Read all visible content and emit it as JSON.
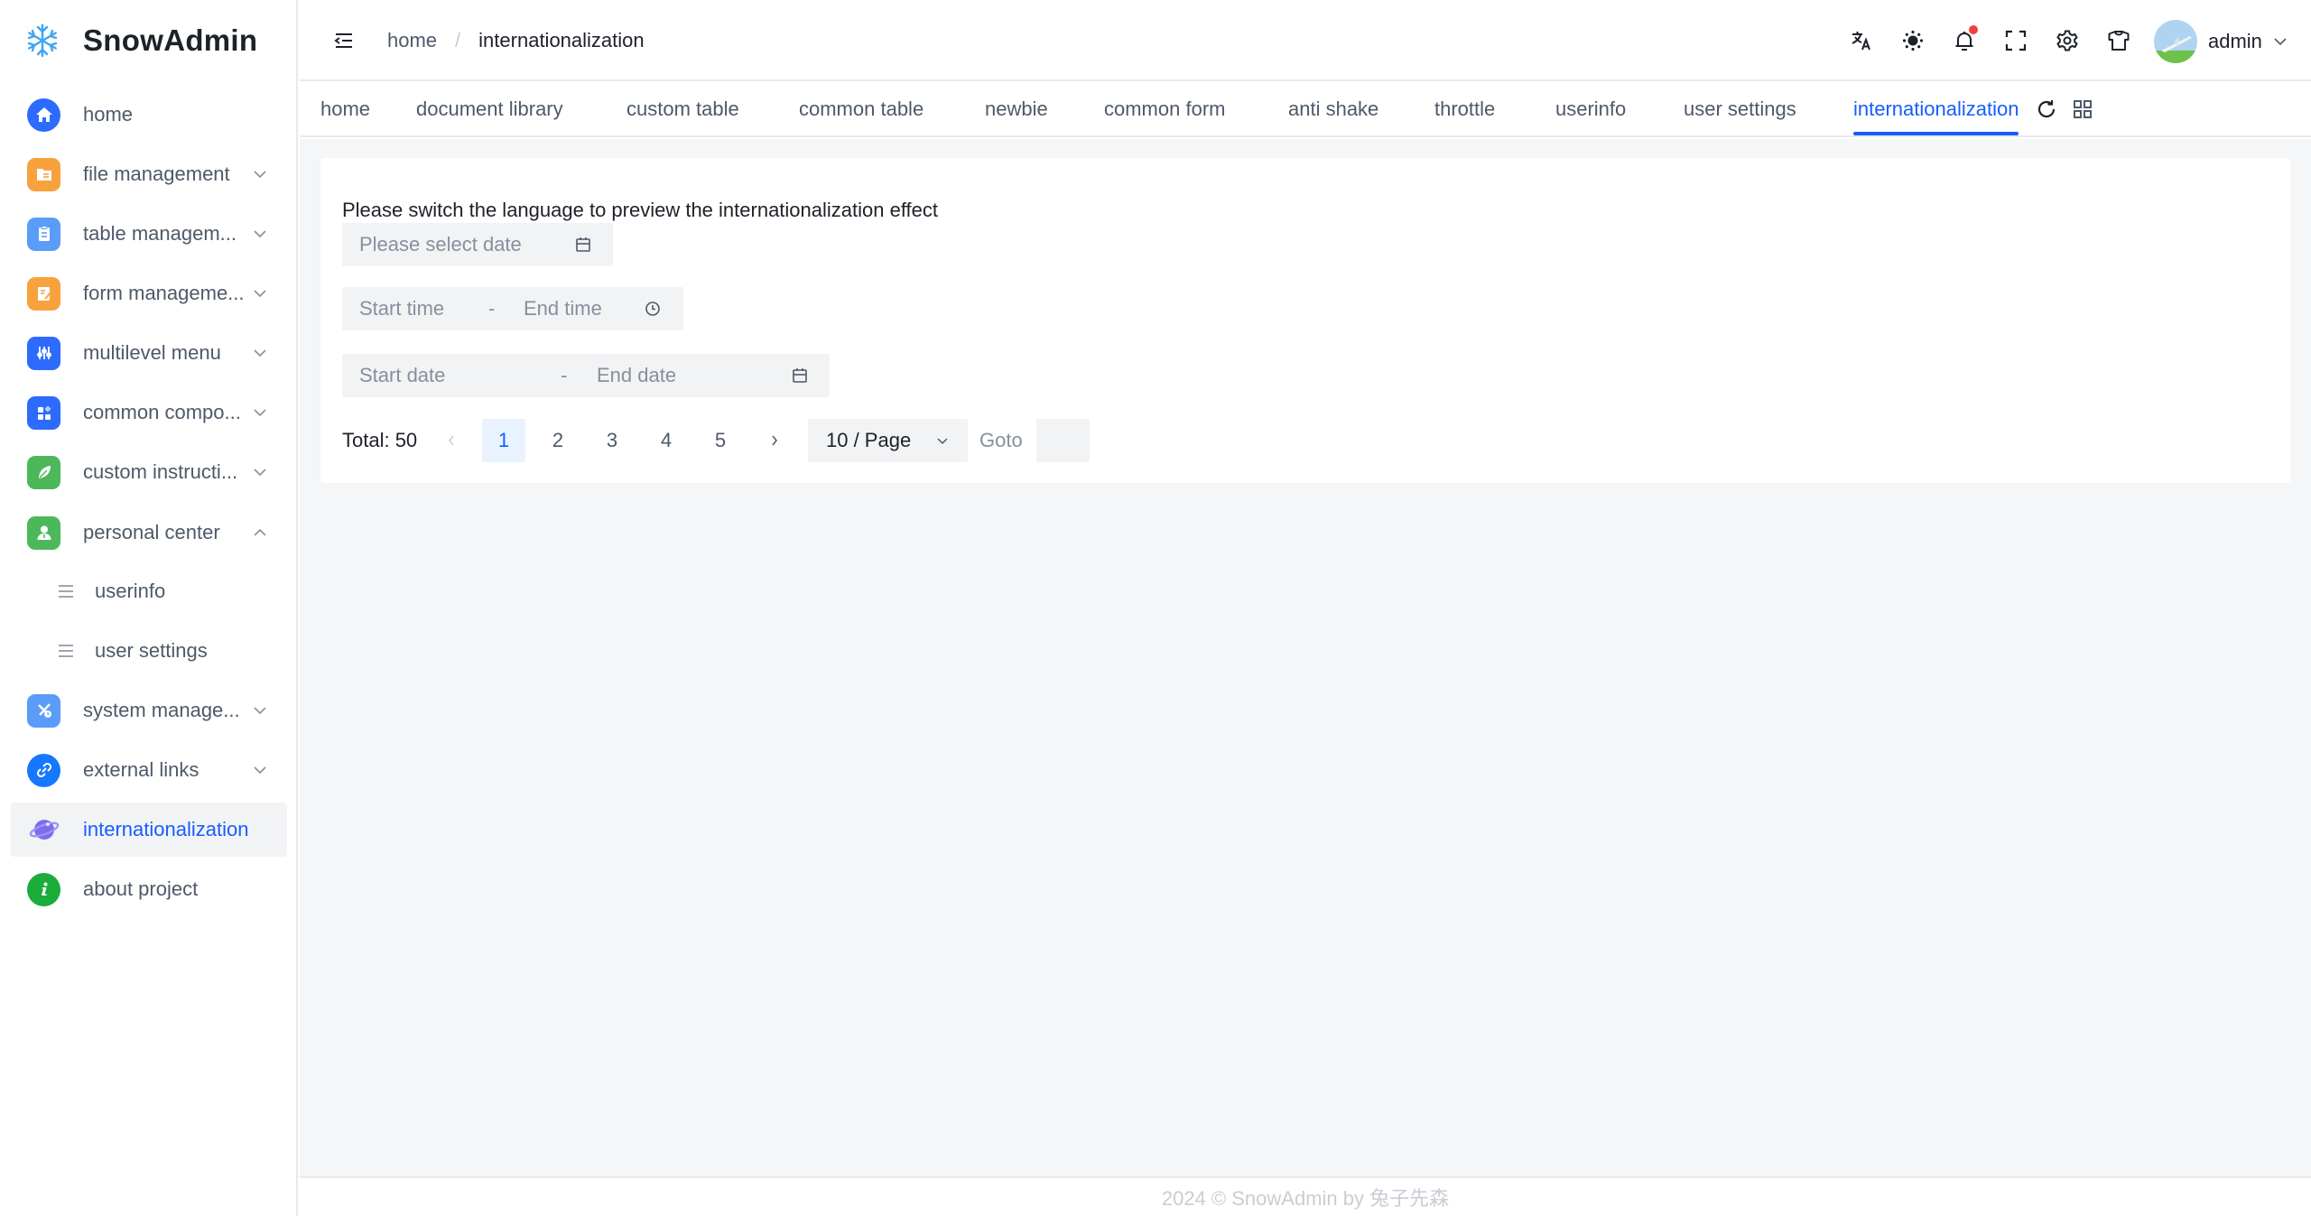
{
  "app": {
    "name": "SnowAdmin"
  },
  "sidebar": {
    "items": [
      {
        "label": "home",
        "icon": "home-icon",
        "color": "#2d6bff",
        "expandable": false
      },
      {
        "label": "file management",
        "icon": "folder-icon",
        "color": "#f7a23c",
        "expandable": true
      },
      {
        "label": "table managem...",
        "icon": "clipboard-icon",
        "color": "#5a9cf8",
        "expandable": true
      },
      {
        "label": "form manageme...",
        "icon": "form-edit-icon",
        "color": "#f7a23c",
        "expandable": true
      },
      {
        "label": "multilevel menu",
        "icon": "sliders-icon",
        "color": "#2d6bff",
        "expandable": true
      },
      {
        "label": "common compo...",
        "icon": "components-icon",
        "color": "#2d6bff",
        "expandable": true
      },
      {
        "label": "custom instructi...",
        "icon": "leaf-icon",
        "color": "#4cb85a",
        "expandable": true
      },
      {
        "label": "personal center",
        "icon": "user-icon",
        "color": "#4cb85a",
        "expandable": true,
        "expanded": true
      },
      {
        "label": "userinfo",
        "icon": "menu-lines-icon",
        "sub": true
      },
      {
        "label": "user settings",
        "icon": "menu-lines-icon",
        "sub": true
      },
      {
        "label": "system manage...",
        "icon": "tools-icon",
        "color": "#5a9cf8",
        "expandable": true
      },
      {
        "label": "external links",
        "icon": "link-icon",
        "color": "#1677ff",
        "expandable": true
      },
      {
        "label": "internationalization",
        "icon": "planet-icon",
        "color": "#7b6cf0",
        "active": true
      },
      {
        "label": "about project",
        "icon": "info-icon",
        "color": "#1aad3b"
      }
    ]
  },
  "header": {
    "breadcrumb": [
      "home",
      "internationalization"
    ],
    "breadcrumb_separator": "/",
    "tools": [
      "translate-icon",
      "theme-sun-icon",
      "bell-icon",
      "fullscreen-icon",
      "settings-gear-icon",
      "skin-shirt-icon"
    ],
    "notification_dot": true,
    "user": {
      "name": "admin"
    }
  },
  "tabs": {
    "items": [
      "home",
      "document library",
      "custom table",
      "common table",
      "newbie",
      "common form",
      "anti shake",
      "throttle",
      "userinfo",
      "user settings",
      "internationalization"
    ],
    "active_index": 10,
    "actions": [
      "refresh-icon",
      "grid-icon"
    ]
  },
  "content": {
    "hint": "Please switch the language to preview the internationalization effect",
    "date_picker": {
      "placeholder": "Please select date"
    },
    "time_range": {
      "start_placeholder": "Start time",
      "separator": "-",
      "end_placeholder": "End time"
    },
    "date_range": {
      "start_placeholder": "Start date",
      "separator": "-",
      "end_placeholder": "End date"
    },
    "pagination": {
      "total_label": "Total: 50",
      "pages": [
        "1",
        "2",
        "3",
        "4",
        "5"
      ],
      "current_page": "1",
      "page_size": "10 / Page",
      "goto_label": "Goto",
      "goto_value": ""
    }
  },
  "footer": {
    "text": "2024 © SnowAdmin by 兔子先森"
  },
  "colors": {
    "primary": "#165dff",
    "bg": "#f5f6f8",
    "field_bg": "#f2f3f5",
    "badge": "#f53f3f"
  }
}
